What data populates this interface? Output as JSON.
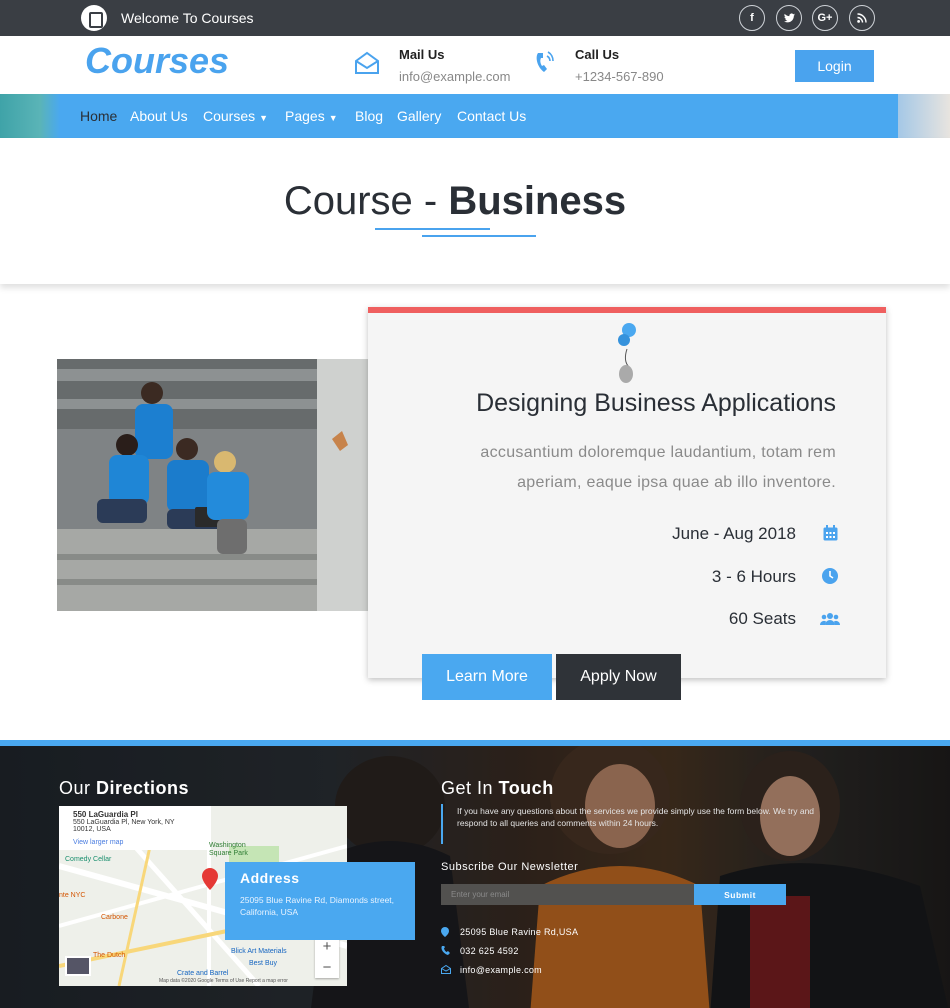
{
  "topbar": {
    "welcome": "Welcome To Courses",
    "social": [
      "f",
      "t",
      "G+",
      "rss"
    ]
  },
  "header": {
    "brand": "Courses",
    "mail_label": "Mail Us",
    "mail_value": "info@example.com",
    "call_label": "Call Us",
    "call_value": "+1234-567-890",
    "login": "Login"
  },
  "nav": {
    "items": [
      "Home",
      "About Us",
      "Courses",
      "Pages",
      "Blog",
      "Gallery",
      "Contact Us"
    ]
  },
  "page": {
    "title_light": "Course - ",
    "title_bold": "Business"
  },
  "course": {
    "title": "Designing Business Applications",
    "description": "accusantium doloremque laudantium, totam rem aperiam, eaque ipsa quae ab illo inventore.",
    "dates": "June - Aug 2018",
    "hours": "3 - 6 Hours",
    "seats": "60 Seats",
    "learn_more": "Learn More",
    "apply_now": "Apply Now"
  },
  "footer": {
    "directions_light": "Our ",
    "directions_bold": "Directions",
    "map": {
      "place": "550 LaGuardia Pl",
      "place_address": "550 LaGuardia Pl, New York, NY 10012, USA",
      "view_larger": "View larger map",
      "labels": [
        "Comedy Cellar",
        "Washington Square Park",
        "nte NYC",
        "Carbone",
        "The Dutch",
        "Blick Art Materials",
        "Best Buy",
        "Crate and Barrel"
      ],
      "attribution": "Map data ©2020 Google   Terms of Use   Report a map error"
    },
    "address_title": "Address",
    "address_text": "25095 Blue Ravine Rd, Diamonds street, California, USA",
    "touch_light": "Get In ",
    "touch_bold": "Touch",
    "touch_text": "If you have any questions about the services we provide simply use the form below. We try and respond to all queries and comments within 24 hours.",
    "newsletter": "Subscribe Our Newsletter",
    "email_placeholder": "Enter your email",
    "submit": "Submit",
    "contact_address": "25095 Blue Ravine Rd,USA",
    "contact_phone": "032 625 4592",
    "contact_email": "info@example.com"
  },
  "colors": {
    "accent": "#4aa8f0",
    "dark": "#2f3338",
    "card_top": "#ef5f5f"
  }
}
